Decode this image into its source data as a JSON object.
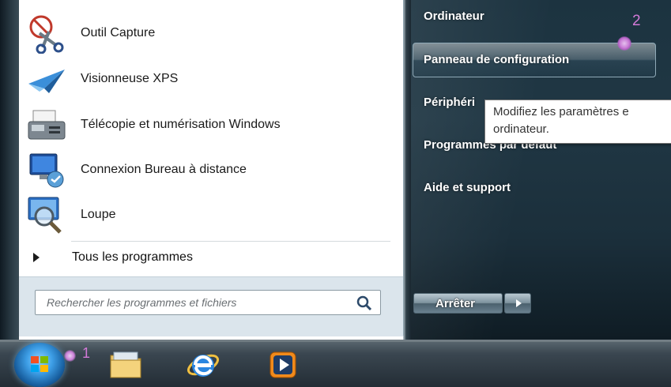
{
  "programs": [
    {
      "label": "Outil Capture",
      "icon": "scissors-icon"
    },
    {
      "label": "Visionneuse XPS",
      "icon": "paper-plane-icon"
    },
    {
      "label": "Télécopie et numérisation Windows",
      "icon": "fax-icon"
    },
    {
      "label": "Connexion Bureau à distance",
      "icon": "remote-desktop-icon"
    },
    {
      "label": "Loupe",
      "icon": "magnifier-icon"
    }
  ],
  "all_programs": {
    "label": "Tous les programmes"
  },
  "search": {
    "placeholder": "Rechercher les programmes et fichiers"
  },
  "right_items": [
    {
      "label": "Ordinateur"
    },
    {
      "label": "Panneau de configuration"
    },
    {
      "label": "Périphéri"
    },
    {
      "label": "Programmes par défaut"
    },
    {
      "label": "Aide et support"
    }
  ],
  "tooltip": {
    "line1": "Modifiez les paramètres e",
    "line2": "ordinateur."
  },
  "shutdown": {
    "label": "Arrêter"
  },
  "annotations": {
    "step1": "1",
    "step2": "2",
    "color": "#d37ad8"
  },
  "taskbar": {
    "icons": [
      "windows-start-orb-icon",
      "folder-libraries-icon",
      "internet-explorer-icon",
      "media-player-icon"
    ]
  }
}
